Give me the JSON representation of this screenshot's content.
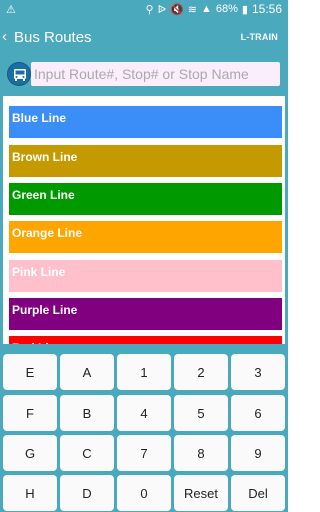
{
  "status_bar": {
    "battery": "68%",
    "time": "15:56"
  },
  "app_bar": {
    "title": "Bus Routes",
    "right_label": "L-TRAIN"
  },
  "search": {
    "placeholder": "Input Route#, Stop# or Stop Name",
    "value": ""
  },
  "routes": [
    {
      "label": "Blue Line",
      "color": "#3b8df7"
    },
    {
      "label": "Brown Line",
      "color": "#c49a00"
    },
    {
      "label": "Green Line",
      "color": "#009a00"
    },
    {
      "label": "Orange Line",
      "color": "#ffa500"
    },
    {
      "label": "Pink Line",
      "color": "#ffc0cb"
    },
    {
      "label": "Purple Line",
      "color": "#800080"
    },
    {
      "label": "Red Line",
      "color": "#ff0000"
    }
  ],
  "keyboard": {
    "rows": [
      [
        "E",
        "A",
        "1",
        "2",
        "3"
      ],
      [
        "F",
        "B",
        "4",
        "5",
        "6"
      ],
      [
        "G",
        "C",
        "7",
        "8",
        "9"
      ],
      [
        "H",
        "D",
        "0",
        "Reset",
        "Del"
      ]
    ]
  },
  "colors": {
    "app_bar": "#4aa9bd",
    "search_bg": "#fbeefc",
    "bus_icon": "#1a6fa0"
  }
}
